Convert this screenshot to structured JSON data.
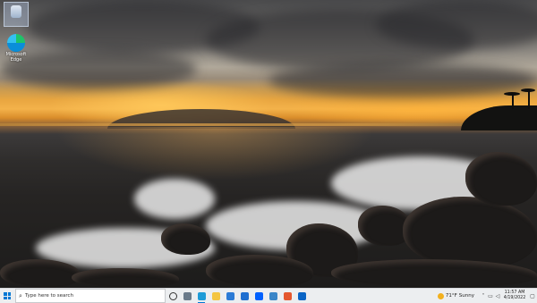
{
  "desktop": {
    "icons": [
      {
        "label": "Recycle Bin",
        "icon": "recycle-bin-icon"
      },
      {
        "label": "Microsoft Edge",
        "icon": "edge-icon"
      }
    ]
  },
  "taskbar": {
    "search": {
      "placeholder": "Type here to search"
    },
    "pinned": [
      {
        "name": "edge",
        "color": "#1e9bd7",
        "active": true
      },
      {
        "name": "file-explorer",
        "color": "#f4c542",
        "active": false
      },
      {
        "name": "microsoft-store",
        "color": "#2b7bd6",
        "active": false
      },
      {
        "name": "mail",
        "color": "#1f6fd0",
        "active": false
      },
      {
        "name": "dropbox",
        "color": "#0061fe",
        "active": false
      },
      {
        "name": "app-settings",
        "color": "#3a86c8",
        "active": false
      },
      {
        "name": "office",
        "color": "#e4572e",
        "active": false
      },
      {
        "name": "outlook",
        "color": "#0a64c5",
        "active": false
      }
    ],
    "weather": {
      "temp": "71°F",
      "condition": "Sunny"
    },
    "clock": {
      "time": "11:57 AM",
      "date": "4/19/2022"
    }
  }
}
